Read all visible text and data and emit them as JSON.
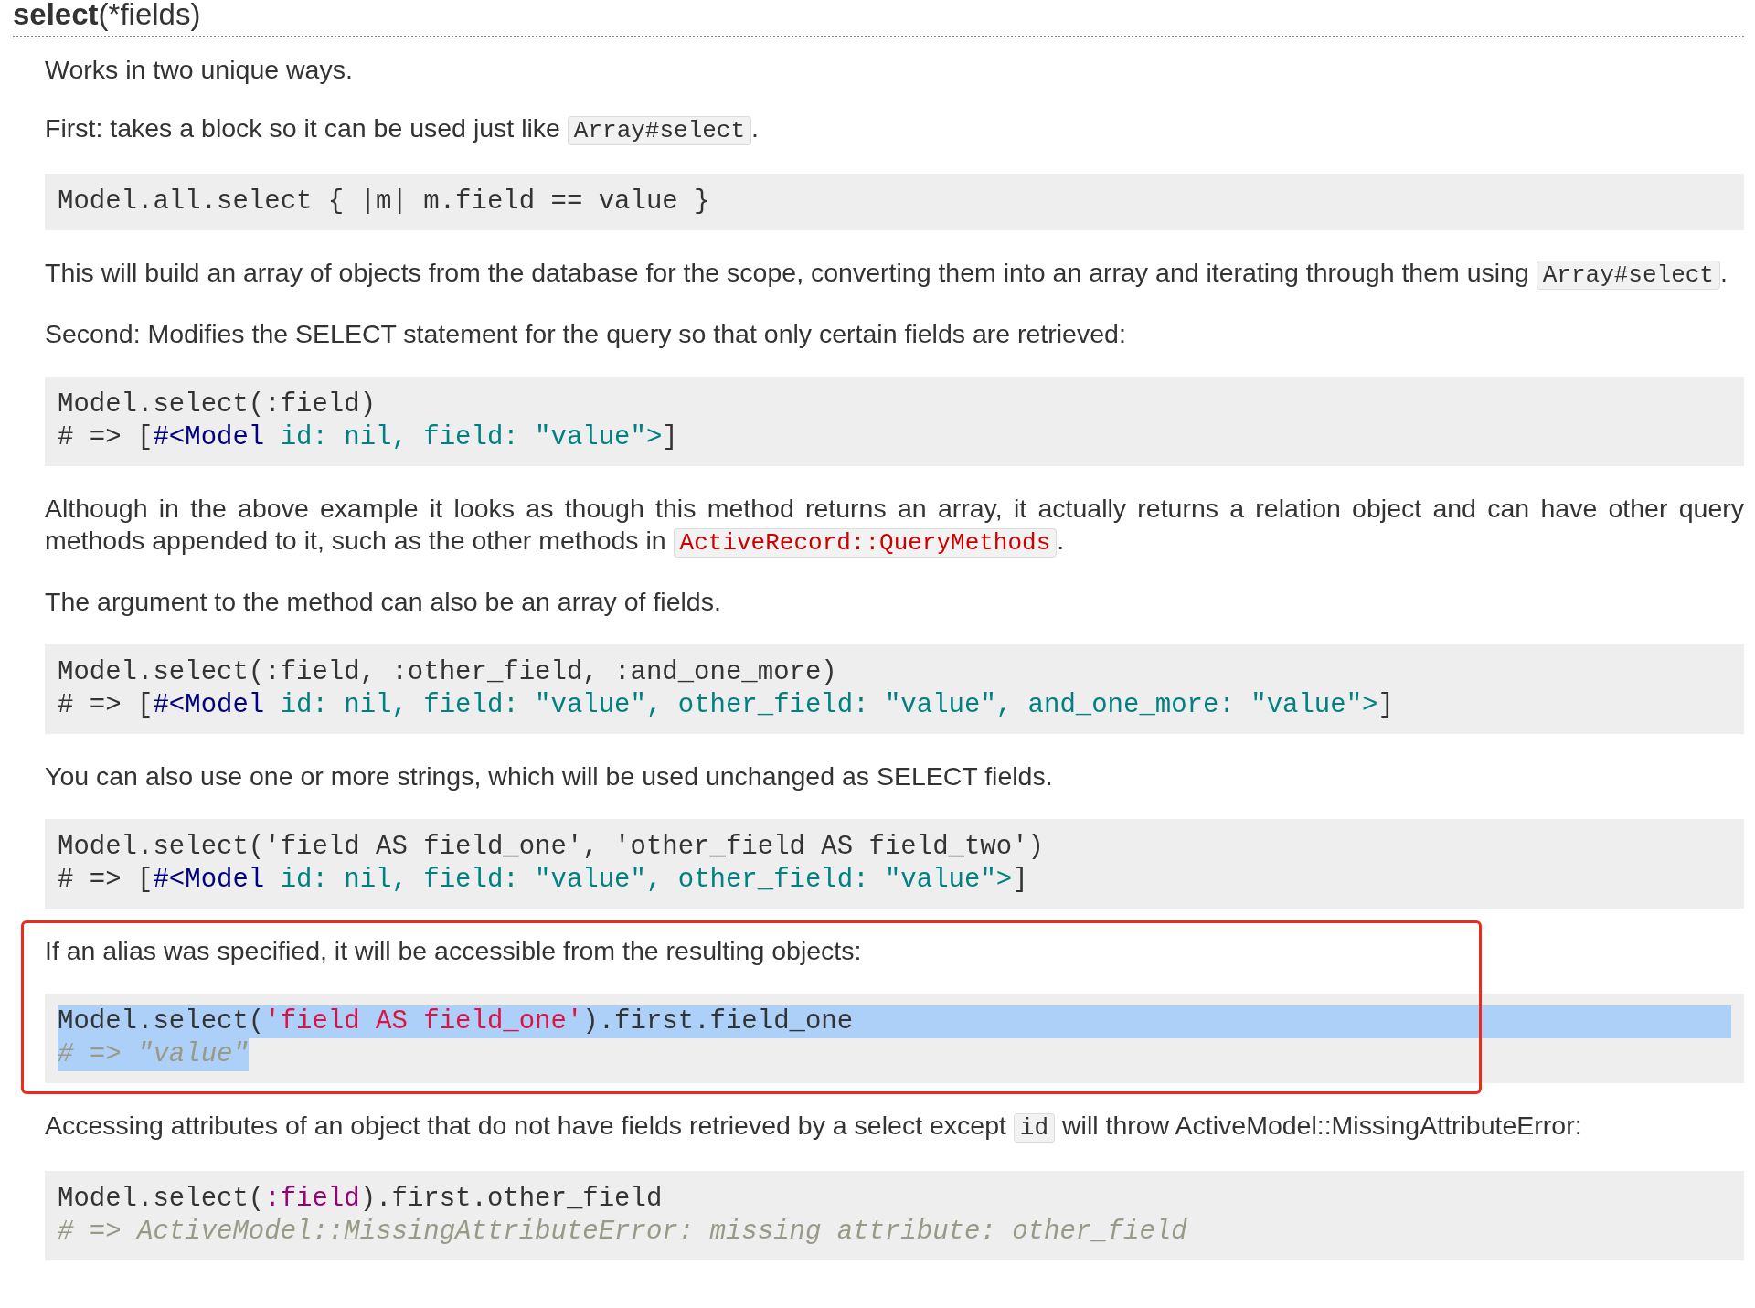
{
  "heading": {
    "name": "select",
    "params": "(*fields)"
  },
  "blocks": [
    {
      "kind": "paragraph",
      "parts": [
        {
          "kind": "text",
          "text": "Works in two unique ways."
        }
      ]
    },
    {
      "kind": "paragraph",
      "parts": [
        {
          "kind": "text",
          "text": "First: takes a block so it can be used just like "
        },
        {
          "kind": "code",
          "text": "Array#select"
        },
        {
          "kind": "text",
          "text": "."
        }
      ]
    },
    {
      "kind": "code",
      "lines": [
        {
          "selected": false,
          "tokens": [
            {
              "kind": "plain",
              "text": "Model.all.select { |m| m.field == value }"
            }
          ]
        }
      ]
    },
    {
      "kind": "paragraph",
      "parts": [
        {
          "kind": "text",
          "text": "This will build an array of objects from the database for the scope, converting them into an array and iterating through them using "
        },
        {
          "kind": "code",
          "text": "Array#select"
        },
        {
          "kind": "text",
          "text": "."
        }
      ]
    },
    {
      "kind": "paragraph",
      "parts": [
        {
          "kind": "text",
          "text": "Second: Modifies the SELECT statement for the query so that only certain fields are retrieved:"
        }
      ]
    },
    {
      "kind": "code",
      "lines": [
        {
          "selected": false,
          "tokens": [
            {
              "kind": "plain",
              "text": "Model.select(:field)"
            }
          ]
        },
        {
          "selected": false,
          "tokens": [
            {
              "kind": "plain",
              "text": "# => ["
            },
            {
              "kind": "class",
              "text": "#<Model"
            },
            {
              "kind": "attr",
              "text": " id: nil, field: \"value\">"
            },
            {
              "kind": "plain",
              "text": "]"
            }
          ]
        }
      ]
    },
    {
      "kind": "paragraph",
      "parts": [
        {
          "kind": "text",
          "text": "Although in the above example it looks as though this method returns an array, it actually returns a relation object and can have other query methods appended to it, such as the other methods in "
        },
        {
          "kind": "link",
          "text": "ActiveRecord::QueryMethods"
        },
        {
          "kind": "text",
          "text": "."
        }
      ]
    },
    {
      "kind": "paragraph",
      "parts": [
        {
          "kind": "text",
          "text": "The argument to the method can also be an array of fields."
        }
      ]
    },
    {
      "kind": "code",
      "lines": [
        {
          "selected": false,
          "tokens": [
            {
              "kind": "plain",
              "text": "Model.select(:field, :other_field, :and_one_more)"
            }
          ]
        },
        {
          "selected": false,
          "tokens": [
            {
              "kind": "plain",
              "text": "# => ["
            },
            {
              "kind": "class",
              "text": "#<Model"
            },
            {
              "kind": "attr",
              "text": " id: nil, field: \"value\", other_field: \"value\", and_one_more: \"value\">"
            },
            {
              "kind": "plain",
              "text": "]"
            }
          ]
        }
      ]
    },
    {
      "kind": "paragraph",
      "parts": [
        {
          "kind": "text",
          "text": "You can also use one or more strings, which will be used unchanged as SELECT fields."
        }
      ]
    },
    {
      "kind": "code",
      "lines": [
        {
          "selected": false,
          "tokens": [
            {
              "kind": "plain",
              "text": "Model.select('field AS field_one', 'other_field AS field_two')"
            }
          ]
        },
        {
          "selected": false,
          "tokens": [
            {
              "kind": "plain",
              "text": "# => ["
            },
            {
              "kind": "class",
              "text": "#<Model"
            },
            {
              "kind": "attr",
              "text": " id: nil, field: \"value\", other_field: \"value\">"
            },
            {
              "kind": "plain",
              "text": "]"
            }
          ]
        }
      ]
    },
    {
      "kind": "annotation",
      "blocks": [
        {
          "kind": "paragraph",
          "parts": [
            {
              "kind": "text",
              "text": "If an alias was specified, it will be accessible from the resulting objects:"
            }
          ]
        },
        {
          "kind": "code",
          "lines": [
            {
              "selected": true,
              "tokens": [
                {
                  "kind": "plain",
                  "text": "Model.select("
                },
                {
                  "kind": "string",
                  "text": "'field AS field_one'"
                },
                {
                  "kind": "plain",
                  "text": ").first.field_one"
                }
              ]
            },
            {
              "selected": true,
              "tokens": [
                {
                  "kind": "comment",
                  "text": "# => \"value\""
                }
              ]
            }
          ]
        }
      ]
    },
    {
      "kind": "paragraph",
      "parts": [
        {
          "kind": "text",
          "text": "Accessing attributes of an object that do not have fields retrieved by a select except "
        },
        {
          "kind": "code",
          "text": "id"
        },
        {
          "kind": "text",
          "text": " will throw ActiveModel::MissingAttributeError:"
        }
      ]
    },
    {
      "kind": "code",
      "lines": [
        {
          "selected": false,
          "tokens": [
            {
              "kind": "plain",
              "text": "Model.select("
            },
            {
              "kind": "symbol",
              "text": ":field"
            },
            {
              "kind": "plain",
              "text": ").first.other_field"
            }
          ]
        },
        {
          "selected": false,
          "tokens": [
            {
              "kind": "comment",
              "text": "# => ActiveModel::MissingAttributeError: missing attribute: other_field"
            }
          ]
        }
      ]
    }
  ]
}
